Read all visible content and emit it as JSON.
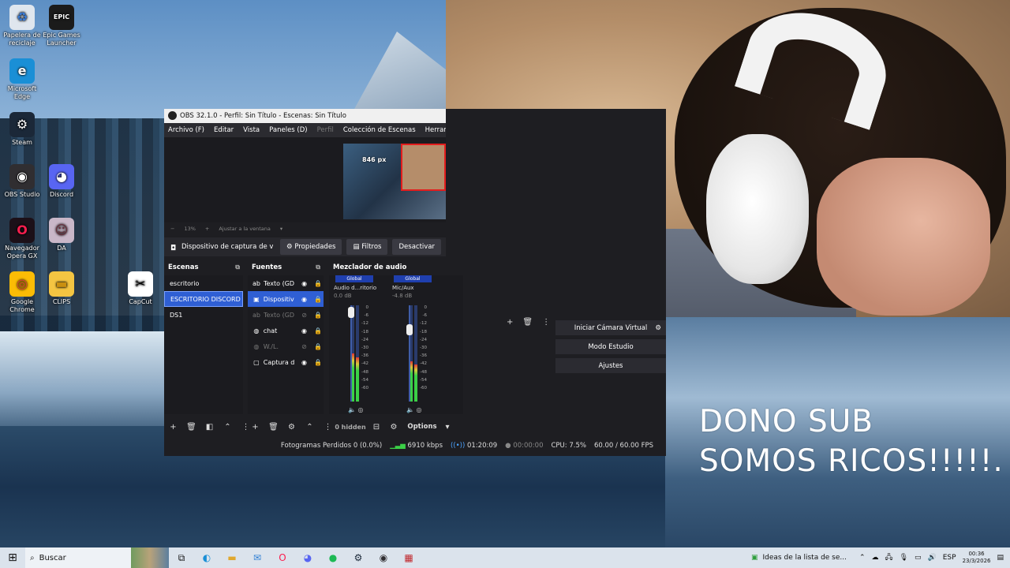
{
  "desktop_icons": [
    {
      "label": "Papelera de reciclaje",
      "icon": "recycle-bin-icon",
      "glyph": "♻",
      "bg": "#dfe6ee",
      "fg": "#3a7bd5"
    },
    {
      "label": "Epic Games Launcher",
      "icon": "epic-games-icon",
      "glyph": "EPIC",
      "bg": "#1b1b1b",
      "fg": "#ffffff"
    },
    {
      "label": "Microsoft Edge",
      "icon": "edge-icon",
      "glyph": "e",
      "bg": "#1a8fd6",
      "fg": "#ffffff"
    },
    {
      "label": "Steam",
      "icon": "steam-icon",
      "glyph": "⚙",
      "bg": "#1b2838",
      "fg": "#ffffff"
    },
    {
      "label": "OBS Studio",
      "icon": "obs-icon",
      "glyph": "◉",
      "bg": "#302e31",
      "fg": "#ffffff"
    },
    {
      "label": "Discord",
      "icon": "discord-icon",
      "glyph": "◕",
      "bg": "#5865f2",
      "fg": "#ffffff"
    },
    {
      "label": "Navegador Opera GX",
      "icon": "opera-gx-icon",
      "glyph": "O",
      "bg": "#1c1018",
      "fg": "#fa1e4e"
    },
    {
      "label": "DA",
      "icon": "da-icon",
      "glyph": "☺",
      "bg": "#c9b7c8",
      "fg": "#6b2d3b"
    },
    {
      "label": "Google Chrome",
      "icon": "chrome-icon",
      "glyph": "◎",
      "bg": "#fbbc05",
      "fg": "#db4437"
    },
    {
      "label": "CLIPS",
      "icon": "folder-icon",
      "glyph": "▬",
      "bg": "#f4c542",
      "fg": "#c98f10"
    },
    {
      "label": "CapCut",
      "icon": "capcut-icon",
      "glyph": "✂",
      "bg": "#ffffff",
      "fg": "#000000"
    }
  ],
  "obs": {
    "title": "OBS 32.1.0 - Perfil: Sin Título - Escenas: Sin Título",
    "menu": [
      "Archivo (F)",
      "Editar",
      "Vista",
      "Paneles (D)",
      "Perfil",
      "Colección de Escenas",
      "Herramientas"
    ],
    "preview_px": "846 px",
    "zoom": "13%",
    "zoom_fit": "Ajustar a la ventana",
    "source_toolbar": {
      "name": "Dispositivo de captura de v",
      "props": "Propiedades",
      "filters": "Filtros",
      "deactivate": "Desactivar"
    },
    "scenes_title": "Escenas",
    "scenes": [
      "escritorio",
      "ESCRITORIO DISCORD",
      "DS1"
    ],
    "sources_title": "Fuentes",
    "sources": [
      {
        "name": "Texto (GD",
        "icon": "text-source-icon",
        "glyph": "ab",
        "visible": true
      },
      {
        "name": "Dispositiv",
        "icon": "camera-source-icon",
        "glyph": "▣",
        "visible": true
      },
      {
        "name": "Texto (GD",
        "icon": "text-source-icon",
        "glyph": "ab",
        "visible": false
      },
      {
        "name": "chat",
        "icon": "browser-source-icon",
        "glyph": "◍",
        "visible": true
      },
      {
        "name": "W./L.",
        "icon": "browser-source-icon",
        "glyph": "◍",
        "visible": false
      },
      {
        "name": "Captura d",
        "icon": "window-capture-icon",
        "glyph": "▢",
        "visible": true
      }
    ],
    "mixer_title": "Mezclador de audio",
    "mixer": [
      {
        "tag": "Global",
        "name": "Audio d...ritorio",
        "db": "0.0 dB",
        "level": 0.5,
        "volume": 0.98
      },
      {
        "tag": "Global",
        "name": "Mic/Aux",
        "db": "-4.8 dB",
        "level": 0.42,
        "volume": 0.78
      }
    ],
    "meter_scale": [
      "0",
      "-6",
      "-12",
      "-18",
      "-24",
      "-30",
      "-36",
      "-42",
      "-48",
      "-54",
      "-60"
    ],
    "hidden_count": "0 hidden",
    "options": "Options",
    "controls": {
      "virtual_cam": "Iniciar Cámara Virtual",
      "studio": "Modo Estudio",
      "settings": "Ajustes"
    },
    "status": {
      "dropped": "Fotogramas Perdidos 0 (0.0%)",
      "bitrate": "6910 kbps",
      "stream_time": "01:20:09",
      "rec_time": "00:00:00",
      "cpu": "CPU: 7.5%",
      "fps": "60.00 / 60.00 FPS"
    }
  },
  "overlay": {
    "line1": "DONO SUB",
    "line2": "SOMOS RICOS!!!!!."
  },
  "taskbar": {
    "search": "Buscar",
    "notice": "Ideas de la lista de se...",
    "lang": "ESP",
    "time": "00:36",
    "date": "23/3/2026"
  }
}
